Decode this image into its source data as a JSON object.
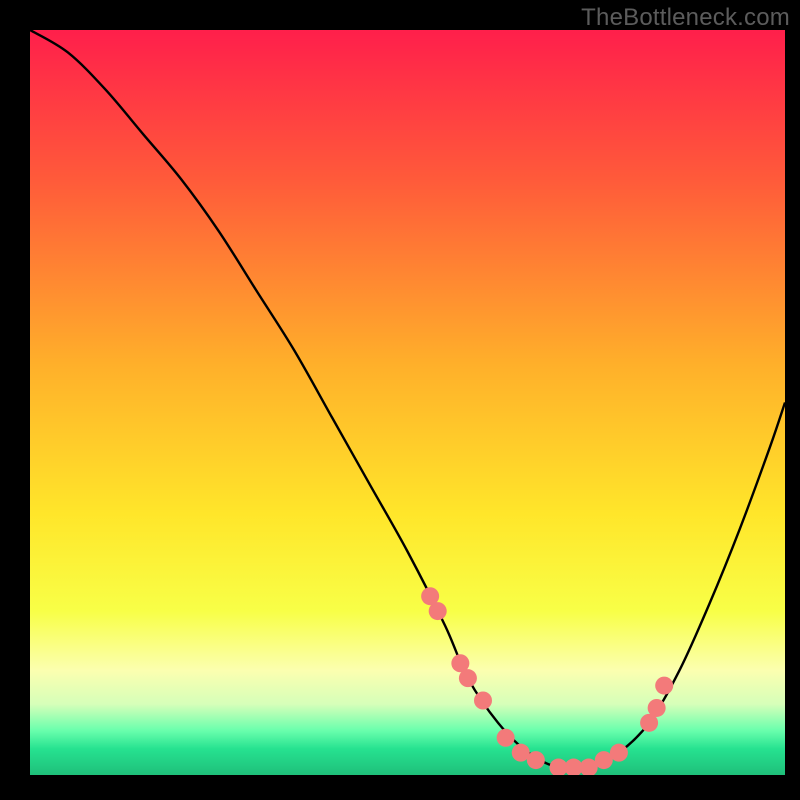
{
  "watermark": "TheBottleneck.com",
  "chart_data": {
    "type": "line",
    "title": "",
    "xlabel": "",
    "ylabel": "",
    "xlim": [
      0,
      100
    ],
    "ylim": [
      0,
      100
    ],
    "grid": false,
    "legend": false,
    "background_gradient": {
      "stops": [
        {
          "offset": 0.0,
          "color": "#ff1f4b"
        },
        {
          "offset": 0.2,
          "color": "#ff5a3a"
        },
        {
          "offset": 0.45,
          "color": "#ffb02a"
        },
        {
          "offset": 0.65,
          "color": "#ffe62a"
        },
        {
          "offset": 0.78,
          "color": "#f8ff47"
        },
        {
          "offset": 0.86,
          "color": "#fbffb0"
        },
        {
          "offset": 0.905,
          "color": "#d6ffb9"
        },
        {
          "offset": 0.94,
          "color": "#6affad"
        },
        {
          "offset": 0.965,
          "color": "#26e290"
        },
        {
          "offset": 1.0,
          "color": "#1fbf7a"
        }
      ]
    },
    "series": [
      {
        "name": "bottleneck-curve",
        "type": "line",
        "x": [
          0,
          5,
          10,
          15,
          20,
          25,
          30,
          35,
          40,
          45,
          50,
          55,
          58,
          62,
          66,
          70,
          74,
          78,
          82,
          86,
          90,
          94,
          98,
          100
        ],
        "y": [
          100,
          97,
          92,
          86,
          80,
          73,
          65,
          57,
          48,
          39,
          30,
          20,
          13,
          7,
          3,
          1,
          1,
          3,
          7,
          14,
          23,
          33,
          44,
          50
        ]
      },
      {
        "name": "data-points",
        "type": "scatter",
        "marker_color": "#f37a7a",
        "marker_radius": 9,
        "x": [
          53,
          54,
          57,
          58,
          60,
          63,
          65,
          67,
          70,
          72,
          74,
          76,
          78,
          82,
          83,
          84
        ],
        "y": [
          24,
          22,
          15,
          13,
          10,
          5,
          3,
          2,
          1,
          1,
          1,
          2,
          3,
          7,
          9,
          12
        ]
      }
    ]
  }
}
